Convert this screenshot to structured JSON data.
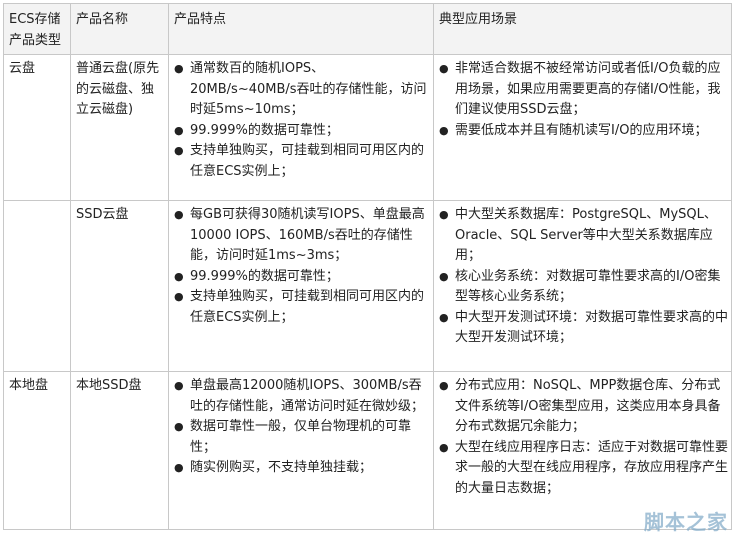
{
  "headers": [
    "ECS存储产品类型",
    "产品名称",
    "产品特点",
    "典型应用场景"
  ],
  "rows": [
    {
      "type": "云盘",
      "name": "普通云盘(原先的云磁盘、独立云磁盘)",
      "features": [
        "通常数百的随机IOPS、20MB/s~40MB/s吞吐的存储性能，访问时延5ms~10ms；",
        "99.999%的数据可靠性；",
        "支持单独购买，可挂载到相同可用区内的任意ECS实例上；"
      ],
      "scenarios": [
        "非常适合数据不被经常访问或者低I/O负载的应用场景，如果应用需要更高的存储I/O性能，我们建议使用SSD云盘；",
        "需要低成本并且有随机读写I/O的应用环境；"
      ]
    },
    {
      "type": "",
      "name": "SSD云盘",
      "features": [
        "每GB可获得30随机读写IOPS、单盘最高10000 IOPS、160MB/s吞吐的存储性能，访问时延1ms~3ms；",
        "99.999%的数据可靠性；",
        "支持单独购买，可挂载到相同可用区内的任意ECS实例上；"
      ],
      "scenarios": [
        "中大型关系数据库：PostgreSQL、MySQL、Oracle、SQL Server等中大型关系数据库应用；",
        "核心业务系统：对数据可靠性要求高的I/O密集型等核心业务系统；",
        "中大型开发测试环境：对数据可靠性要求高的中大型开发测试环境；"
      ]
    },
    {
      "type": "本地盘",
      "name": "本地SSD盘",
      "features": [
        "单盘最高12000随机IOPS、300MB/s吞吐的存储性能，通常访问时延在微妙级；",
        "数据可靠性一般，仅单台物理机的可靠性；",
        "随实例购买，不支持单独挂载；"
      ],
      "scenarios": [
        "分布式应用：NoSQL、MPP数据仓库、分布式文件系统等I/O密集型应用，这类应用本身具备分布式数据冗余能力；",
        "大型在线应用程序日志：适应于对数据可靠性要求一般的大型在线应用程序，存放应用程序产生的大量日志数据；"
      ]
    }
  ],
  "watermark": "脚本之家"
}
